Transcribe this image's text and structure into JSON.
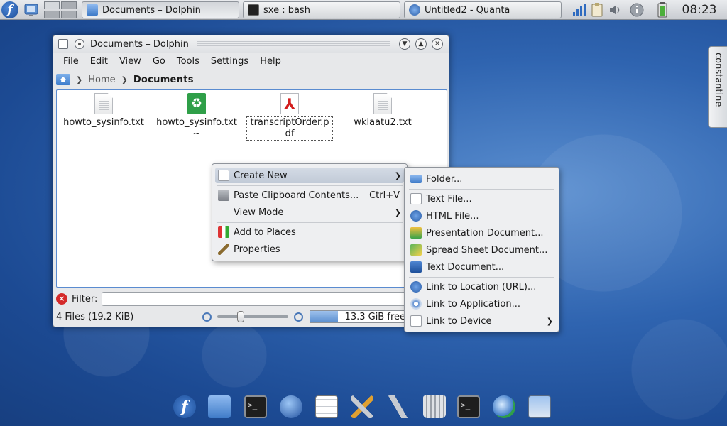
{
  "panel": {
    "kicker_glyph": "f",
    "tasks": [
      {
        "label": "Documents – Dolphin",
        "icon": "folder-icon",
        "active": true
      },
      {
        "label": "sxe : bash",
        "icon": "terminal-icon",
        "active": false
      },
      {
        "label": "Untitled2 - Quanta",
        "icon": "quanta-icon",
        "active": false
      }
    ],
    "clock": "08:23"
  },
  "window": {
    "title": "Documents – Dolphin",
    "menu": [
      "File",
      "Edit",
      "View",
      "Go",
      "Tools",
      "Settings",
      "Help"
    ],
    "breadcrumb": {
      "home": "Home",
      "current": "Documents"
    },
    "files": [
      {
        "name": "howto_sysinfo.txt",
        "icon": "text-file-icon"
      },
      {
        "name": "howto_sysinfo.txt~",
        "icon": "backup-file-icon"
      },
      {
        "name": "transcriptOrder.pdf",
        "icon": "pdf-file-icon"
      },
      {
        "name": "wklaatu2.txt",
        "icon": "text-file-icon"
      }
    ],
    "filter_label": "Filter:",
    "status": "4 Files (19.2 KiB)",
    "free_space": "13.3 GiB free",
    "space_used_fraction": 0.28
  },
  "context_menu": {
    "items": [
      {
        "label": "Create New",
        "shortcut": "",
        "submenu": true,
        "highlighted": true
      },
      {
        "label": "Paste Clipboard Contents...",
        "shortcut": "Ctrl+V"
      },
      {
        "label": "View Mode",
        "shortcut": "",
        "submenu": true
      },
      {
        "label": "Add to Places",
        "shortcut": ""
      },
      {
        "label": "Properties",
        "shortcut": ""
      }
    ]
  },
  "submenu": {
    "items": [
      {
        "label": "Folder..."
      },
      {
        "label": "Text File..."
      },
      {
        "label": "HTML File..."
      },
      {
        "label": "Presentation Document..."
      },
      {
        "label": "Spread Sheet Document..."
      },
      {
        "label": "Text Document..."
      },
      {
        "label": "Link to Location (URL)..."
      },
      {
        "label": "Link to Application..."
      },
      {
        "label": "Link to Device"
      }
    ]
  },
  "side_panel": {
    "label": "constantine"
  },
  "colors": {
    "accent": "#5a8bd0",
    "desktop": "#2f64b0",
    "menu_highlight": "#c1cad7"
  },
  "dock": [
    "fedora-icon",
    "home-folder-icon",
    "terminal-icon",
    "globe-icon",
    "text-editor-icon",
    "tools-icon",
    "settings-icon",
    "trash-icon",
    "terminal-icon",
    "network-icon",
    "file-manager-icon"
  ]
}
